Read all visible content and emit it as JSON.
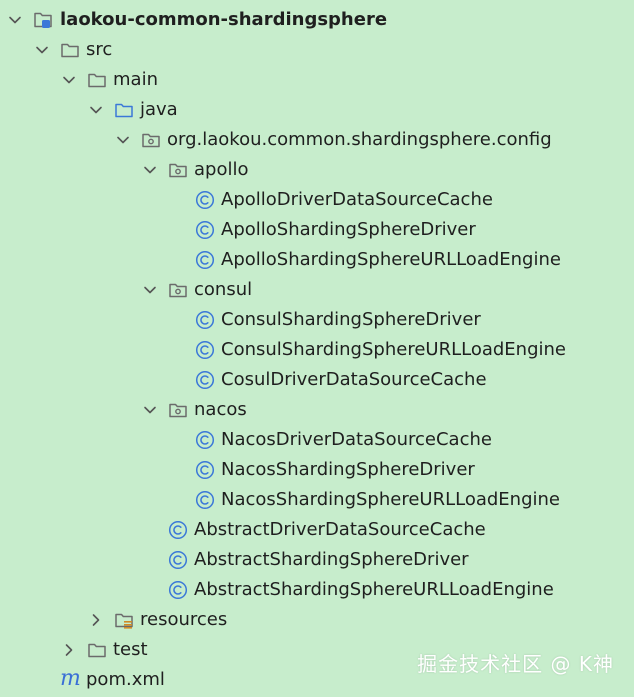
{
  "tree": {
    "root": {
      "label": "laokou-common-shardingsphere"
    },
    "src": {
      "label": "src"
    },
    "main": {
      "label": "main"
    },
    "java": {
      "label": "java"
    },
    "package": {
      "label": "org.laokou.common.shardingsphere.config"
    },
    "apollo": {
      "label": "apollo",
      "classes": [
        "ApolloDriverDataSourceCache",
        "ApolloShardingSphereDriver",
        "ApolloShardingSphereURLLoadEngine"
      ]
    },
    "consul": {
      "label": "consul",
      "classes": [
        "ConsulShardingSphereDriver",
        "ConsulShardingSphereURLLoadEngine",
        "CosulDriverDataSourceCache"
      ]
    },
    "nacos": {
      "label": "nacos",
      "classes": [
        "NacosDriverDataSourceCache",
        "NacosShardingSphereDriver",
        "NacosShardingSphereURLLoadEngine"
      ]
    },
    "abstract_classes": [
      "AbstractDriverDataSourceCache",
      "AbstractShardingSphereDriver",
      "AbstractShardingSphereURLLoadEngine"
    ],
    "resources": {
      "label": "resources"
    },
    "test": {
      "label": "test"
    },
    "pom": {
      "label": "pom.xml",
      "icon_letter": "m"
    }
  },
  "watermark": "掘金技术社区 @ K神",
  "colors": {
    "background": "#c7edcc",
    "class_icon": "#3b78d8",
    "folder_stroke": "#6b6b6b",
    "module_badge": "#3b78d8",
    "maven_icon": "#3a6fd6"
  },
  "icons": {
    "expanded": "chevron-down-icon",
    "collapsed": "chevron-right-icon",
    "module": "module-folder-icon",
    "folder": "folder-icon",
    "source_folder": "source-folder-icon",
    "package": "package-icon",
    "class": "class-icon",
    "resources": "resources-folder-icon",
    "maven": "maven-icon"
  }
}
